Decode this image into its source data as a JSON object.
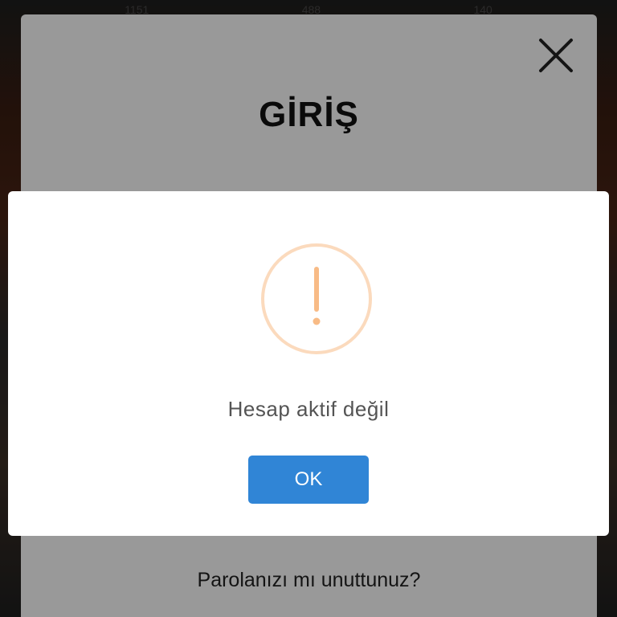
{
  "background": {
    "topbar_stats": [
      "1151",
      "488",
      "140"
    ]
  },
  "login": {
    "title": "GİRİŞ",
    "close_icon": "close-icon",
    "forgot_password_link": "Parolanızı mı unuttunuz?"
  },
  "alert": {
    "icon": "warning-icon",
    "icon_color": "#f8bb86",
    "message": "Hesap aktif değil",
    "ok_label": "OK",
    "ok_color": "#3085d6"
  }
}
